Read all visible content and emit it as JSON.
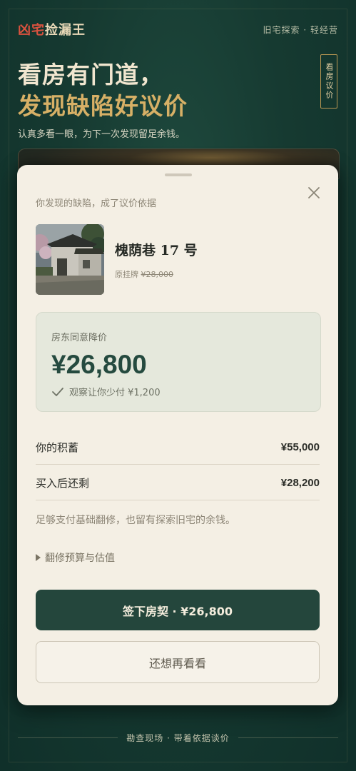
{
  "header": {
    "brand_part1": "凶宅",
    "brand_part2": "捡漏王",
    "nav_text": "旧宅探索 · 轻经营"
  },
  "hero": {
    "line1": "看房有门道，",
    "line2": "发现缺陷好议价",
    "subtitle": "认真多看一眼，为下一次发现留足余钱。",
    "side_tag": "看房议价"
  },
  "sheet": {
    "title": "你发现的缺陷，成了议价依据",
    "property": {
      "name": "槐荫巷 17 号",
      "original_label": "原挂牌",
      "original_price": "¥28,000"
    },
    "price_box": {
      "label": "房东同意降价",
      "amount": "¥26,800",
      "note": "观察让你少付 ¥1,200"
    },
    "rows": [
      {
        "label": "你的积蓄",
        "value": "¥55,000"
      },
      {
        "label": "买入后还剩",
        "value": "¥28,200"
      }
    ],
    "summary": "足够支付基础翻修，也留有探索旧宅的余钱。",
    "expander_label": "翻修预算与估值",
    "primary_button": "签下房契 · ¥26,800",
    "secondary_button": "还想再看看"
  },
  "footer": {
    "text": "勘查现场 · 带着依据谈价"
  },
  "colors": {
    "background": "#163a31",
    "accent_gold": "#d7b066",
    "brand_red": "#d9523f",
    "sheet_bg": "#f4efe4",
    "primary_green": "#24463c"
  },
  "icons": {
    "close": "close-icon",
    "check": "check-icon",
    "expand": "triangle-right-icon"
  }
}
